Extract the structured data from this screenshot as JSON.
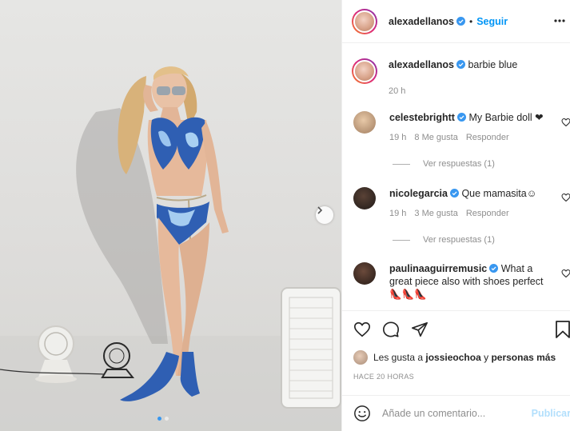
{
  "post": {
    "author": "alexadellanos",
    "follow_label": "Seguir",
    "separator": "•",
    "caption_text": "barbie blue",
    "caption_time": "20 h",
    "more_icon": "more-horizontal-icon",
    "verified_icon": "verified-badge-icon",
    "accent": "#0095f6"
  },
  "comments": [
    {
      "user": "celestebrightt",
      "text": "My Barbie doll ❤",
      "time": "19 h",
      "likes": "8 Me gusta",
      "reply_label": "Responder",
      "view_replies": "Ver respuestas (1)"
    },
    {
      "user": "nicolegarcia",
      "text": "Que mamasita☺",
      "time": "19 h",
      "likes": "3 Me gusta",
      "reply_label": "Responder",
      "view_replies": "Ver respuestas (1)"
    },
    {
      "user": "paulinaaguirremusic",
      "text": "What a great piece also with shoes perfect 👠👠👠"
    }
  ],
  "likes_line": {
    "prefix": "Les gusta a ",
    "user": "jossieochoa",
    "middle": " y ",
    "others": "personas más"
  },
  "timestamp": "HACE 20 HORAS",
  "add_comment": {
    "placeholder": "Añade un comentario...",
    "publish_label": "Publicar"
  },
  "carousel": {
    "slides": 2,
    "current": 1
  }
}
